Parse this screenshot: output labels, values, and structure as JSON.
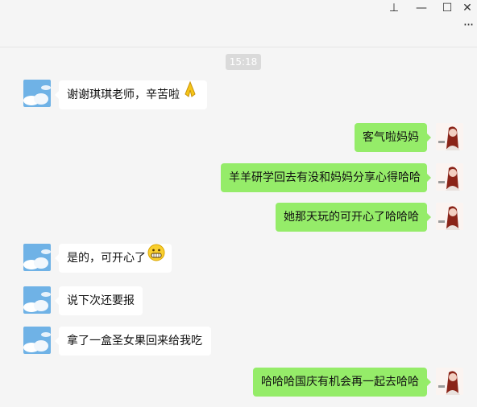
{
  "window": {
    "pin_glyph": "⊥",
    "minimize_glyph": "—",
    "maximize_glyph": "☐",
    "close_glyph": "✕",
    "more_glyph": "···"
  },
  "timestamp": "15:18",
  "messages": [
    {
      "side": "in",
      "text": "谢谢琪琪老师，辛苦啦",
      "emoji": "folded-hands-icon"
    },
    {
      "side": "out",
      "text": "客气啦妈妈"
    },
    {
      "side": "out",
      "text": "羊羊研学回去有没和妈妈分享心得哈哈"
    },
    {
      "side": "out",
      "text": "她那天玩的可开心了哈哈哈"
    },
    {
      "side": "in",
      "text": "是的，可开心了",
      "emoji": "grinning-face-icon"
    },
    {
      "side": "in",
      "text": "说下次还要报"
    },
    {
      "side": "in",
      "text": "拿了一盒圣女果回来给我吃"
    },
    {
      "side": "out",
      "text": "哈哈哈国庆有机会再一起去哈哈"
    }
  ],
  "colors": {
    "background": "#f5f5f5",
    "incoming_bubble": "#ffffff",
    "outgoing_bubble": "#95ec69",
    "timestamp_chip": "#dadada"
  }
}
